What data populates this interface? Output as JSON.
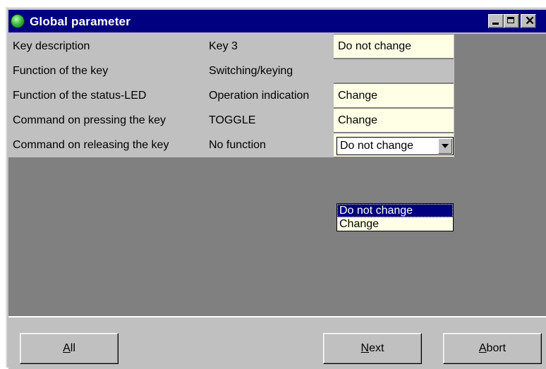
{
  "window": {
    "title": "Global parameter"
  },
  "rows": [
    {
      "label": "Key description",
      "value": "Key 3",
      "option": "Do not change"
    },
    {
      "label": "Function of the key",
      "value": "Switching/keying",
      "option": ""
    },
    {
      "label": "Function of the status-LED",
      "value": "Operation indication",
      "option": "Change"
    },
    {
      "label": "Command on pressing the key",
      "value": "TOGGLE",
      "option": "Change"
    },
    {
      "label": "Command on releasing the key",
      "value": "No function",
      "option": "Do not change"
    }
  ],
  "dropdown": {
    "options": [
      "Do not change",
      "Change"
    ],
    "selected_index": 0
  },
  "buttons": {
    "all": {
      "accel": "A",
      "rest": "ll"
    },
    "next": {
      "accel": "N",
      "rest": "ext"
    },
    "abort": {
      "accel": "A",
      "rest": "bort"
    }
  },
  "colors": {
    "title_bar": "#000080",
    "cell_bg": "#ffffe6",
    "selection": "#000080",
    "workspace": "#808080"
  }
}
